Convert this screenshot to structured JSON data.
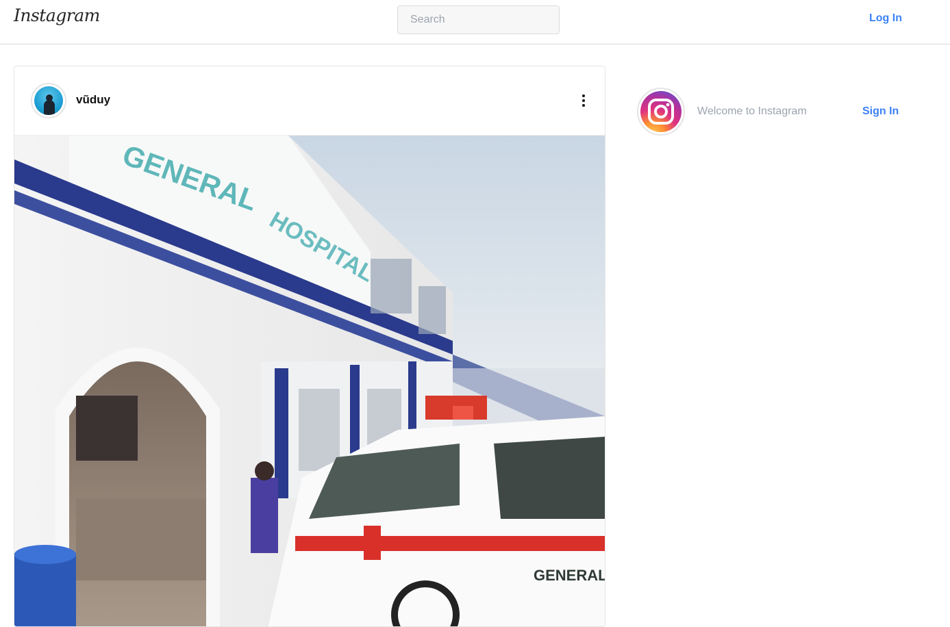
{
  "header": {
    "logo_text": "Instagram",
    "search_placeholder": "Search",
    "login_label": "Log In"
  },
  "post": {
    "username": "vũduy",
    "avatar_icon": "user-avatar",
    "more_icon": "more-options-icon",
    "image_icon": "hospital-photo"
  },
  "sidebar": {
    "brand_icon": "instagram-logo-icon",
    "welcome_text": "Welcome to Instagram",
    "signin_label": "Sign In"
  },
  "colors": {
    "accent": "#3b82f6",
    "muted_text": "#9ca3af",
    "border": "#dbdbdb"
  }
}
